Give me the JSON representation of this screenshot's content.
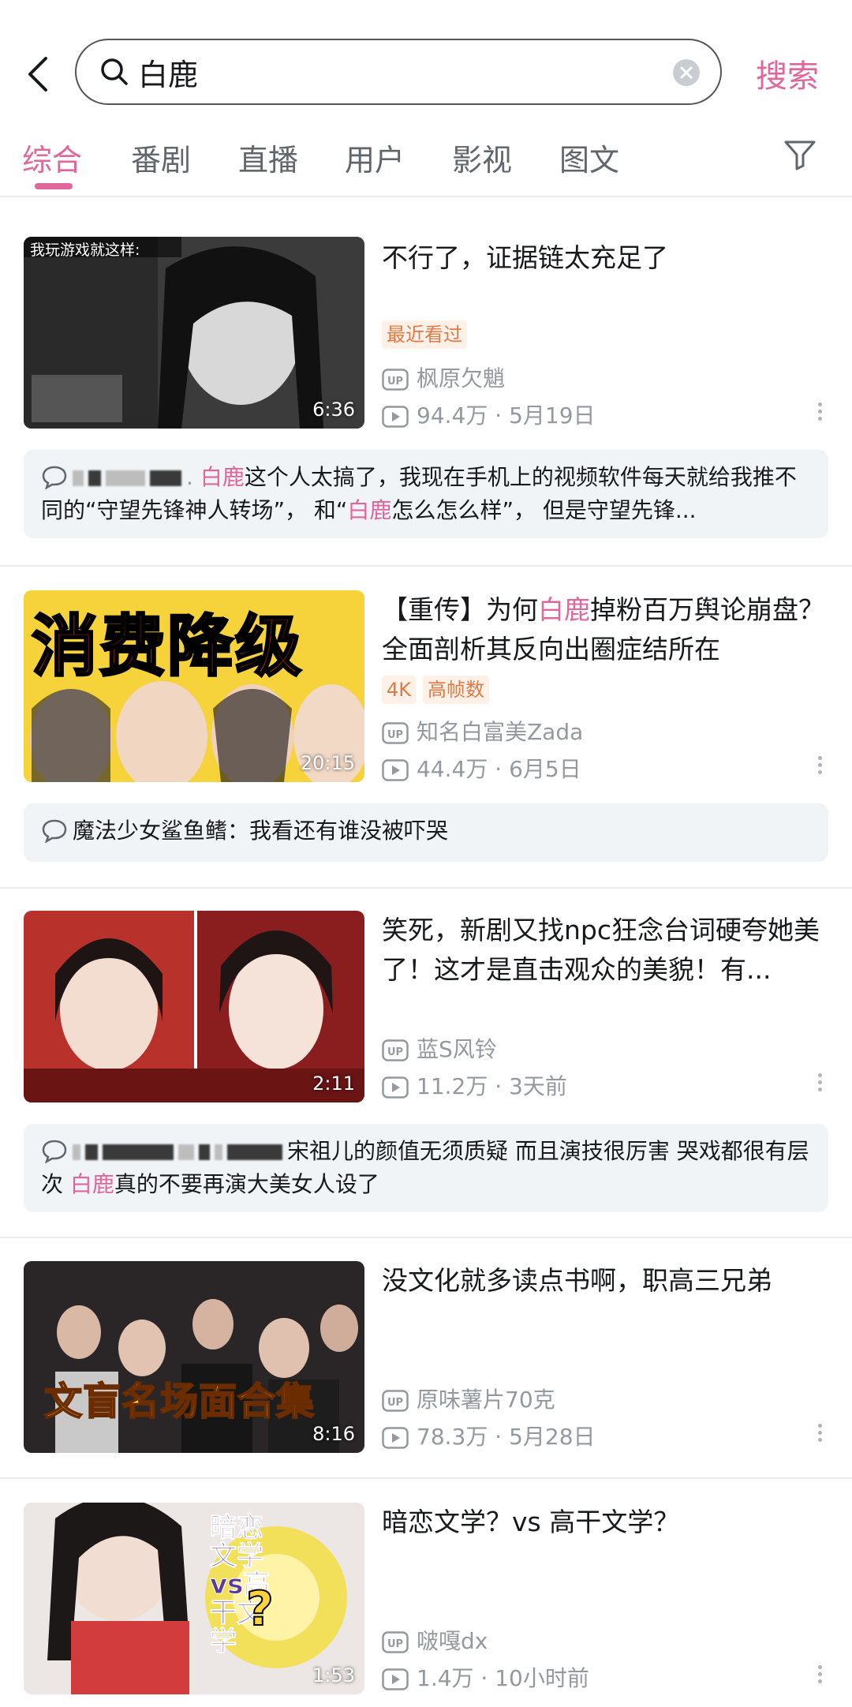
{
  "search": {
    "query": "白鹿",
    "submit_label": "搜索"
  },
  "tabs": [
    {
      "label": "综合"
    },
    {
      "label": "番剧"
    },
    {
      "label": "直播"
    },
    {
      "label": "用户"
    },
    {
      "label": "影视"
    },
    {
      "label": "图文"
    }
  ],
  "colors": {
    "accent": "#e0669b",
    "badge": "#e07a45",
    "meta": "#9499a0"
  },
  "results": [
    {
      "thumb_caption": "我玩游戏就这样:",
      "duration": "6:36",
      "title": "不行了，证据链太充足了",
      "badges": [
        "最近看过"
      ],
      "up_name": "枫原欠魈",
      "views": "94.4万",
      "date": "5月19日",
      "comment": {
        "highlight": "白鹿",
        "text_a": "这个人太搞了，我现在手机上的视频软件每天就给我推不同的“守望先锋神人转场”， 和“",
        "highlight_b": "白鹿",
        "text_b": "怎么怎么样”， 但是守望先锋..."
      }
    },
    {
      "thumb_text": "消费降级",
      "duration": "20:15",
      "title_a": "【重传】为何",
      "title_hl": "白鹿",
      "title_b": "掉粉百万舆论崩盘？全面剖析其反向出圈症结所在",
      "badges": [
        "4K",
        "高帧数"
      ],
      "up_name": "知名白富美Zada",
      "views": "44.4万",
      "date": "6月5日",
      "comment": {
        "author": "魔法少女鲨鱼鳍：",
        "text": "我看还有谁没被吓哭"
      }
    },
    {
      "duration": "2:11",
      "title": "笑死，新剧又找npc狂念台词硬夸她美了！这才是直击观众的美貌！有...",
      "up_name": "蓝S风铃",
      "views": "11.2万",
      "date": "3天前",
      "comment": {
        "text_a": "宋祖儿的颜值无须质疑 而且演技很厉害 哭戏都很有层次 ",
        "highlight": "白鹿",
        "text_b": "真的不要再演大美女人设了"
      }
    },
    {
      "thumb_text": "文盲名场面合集",
      "duration": "8:16",
      "title": "没文化就多读点书啊，职高三兄弟",
      "up_name": "原味薯片70克",
      "views": "78.3万",
      "date": "5月28日"
    },
    {
      "thumb_text": "暗恋文学vs高干文学",
      "duration": "1:53",
      "title": "暗恋文学？vs 高干文学？",
      "up_name": "啵嘎dx",
      "views": "1.4万",
      "date": "10小时前"
    }
  ]
}
